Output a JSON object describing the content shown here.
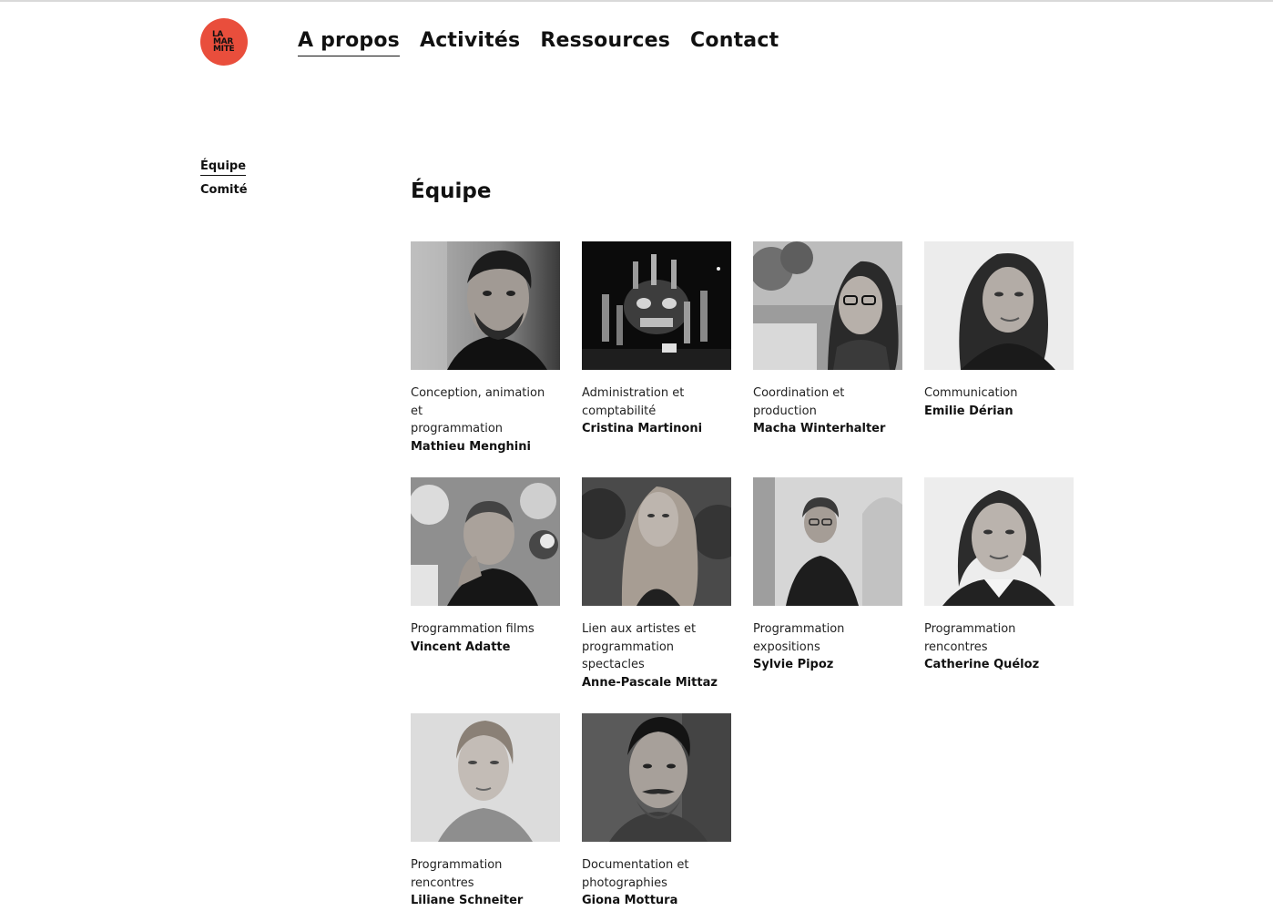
{
  "logo": {
    "lines": [
      "LA",
      "MAR",
      "MITE"
    ],
    "color": "#e94e3c"
  },
  "nav": {
    "items": [
      {
        "label": "A propos",
        "active": true
      },
      {
        "label": "Activités",
        "active": false
      },
      {
        "label": "Ressources",
        "active": false
      },
      {
        "label": "Contact",
        "active": false
      }
    ]
  },
  "sidebar": {
    "items": [
      {
        "label": "Équipe",
        "active": true
      },
      {
        "label": "Comité",
        "active": false
      }
    ]
  },
  "section": {
    "title": "Équipe"
  },
  "team": [
    {
      "role": "Conception, animation et\nprogrammation",
      "name": "Mathieu Menghini"
    },
    {
      "role": "Administration et\ncomptabilité",
      "name": "Cristina Martinoni"
    },
    {
      "role": "Coordination et\nproduction",
      "name": "Macha Winterhalter"
    },
    {
      "role": "Communication",
      "name": "Emilie Dérian"
    },
    {
      "role": "Programmation films",
      "name": "Vincent Adatte"
    },
    {
      "role": "Lien aux artistes et\nprogrammation\nspectacles",
      "name": "Anne-Pascale Mittaz"
    },
    {
      "role": "Programmation\nexpositions",
      "name": "Sylvie Pipoz"
    },
    {
      "role": "Programmation\nrencontres",
      "name": "Catherine Quéloz"
    },
    {
      "role": "Programmation\nrencontres",
      "name": "Liliane Schneiter"
    },
    {
      "role": "Documentation et\nphotographies",
      "name": "Giona Mottura"
    }
  ]
}
